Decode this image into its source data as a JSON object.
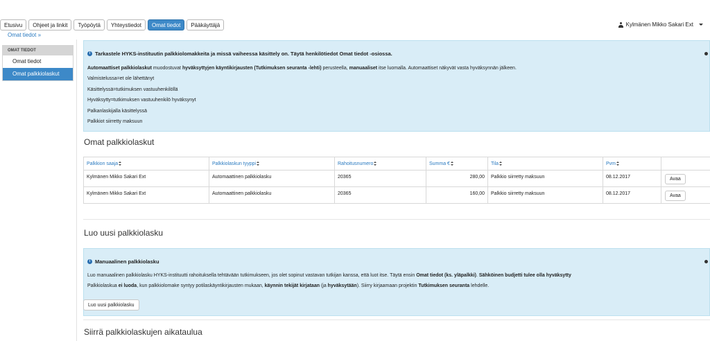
{
  "nav": {
    "tabs": [
      {
        "label": "Etusivu"
      },
      {
        "label": "Ohjeet ja linkit"
      },
      {
        "label": "Työpöytä"
      },
      {
        "label": "Yhteystiedot"
      },
      {
        "label": "Omat tiedot",
        "active": true
      },
      {
        "label": "Pääkäyttäjä"
      }
    ]
  },
  "user": {
    "name": "Kylmänen Mikko Sakari Ext"
  },
  "breadcrumb": "Omat tiedot »",
  "sidebar": {
    "header": "OMAT TIEDOT",
    "items": [
      {
        "label": "Omat tiedot"
      },
      {
        "label": "Omat palkkiolaskut",
        "active": true
      }
    ]
  },
  "info1": {
    "title": "Tarkastele HYKS-instituutin palkkiolomakkeita ja missä vaiheessa käsittely on. Täytä henkilötiedot Omat tiedot -osiossa.",
    "p1_b1": "Automaattiset palkkiolaskut",
    "p1_t1": " muodostuvat ",
    "p1_b2": "hyväksyttyjen käyntikirjausten (Tutkimuksen seuranta -lehti)",
    "p1_t2": " perusteella, ",
    "p1_b3": "manuaaliset",
    "p1_t3": " itse luomalla. Automaattiset näkyvät vasta hyväksynnän jälkeen.",
    "statuses": [
      "Valmistelussa=et ole lähettänyt",
      "Käsittelyssä=tutkimuksen vastuuhenkilöllä",
      "Hyväksytty=tutkimuksen vastuuhenkilö hyväksynyt",
      "Palkanlaskijalla käsittelyssä",
      "Palkkiot siirretty maksuun"
    ]
  },
  "section1_title": "Omat palkkiolaskut",
  "table": {
    "columns": [
      "Palkkion saaja",
      "Palkkiolaskun tyyppi",
      "Rahoitusnumero",
      "Summa €",
      "Tila",
      "Pvm"
    ],
    "rows": [
      {
        "saaja": "Kylmänen Mikko Sakari Ext",
        "tyyppi": "Automaattinen palkkiolasku",
        "rahoitus": "20365",
        "summa": "280,00",
        "tila": "Palkkio siirretty maksuun",
        "pvm": "08.12.2017",
        "action": "Avaa"
      },
      {
        "saaja": "Kylmänen Mikko Sakari Ext",
        "tyyppi": "Automaattinen palkkiolasku",
        "rahoitus": "20365",
        "summa": "160,00",
        "tila": "Palkkio siirretty maksuun",
        "pvm": "08.12.2017",
        "action": "Avaa"
      }
    ]
  },
  "section2_title": "Luo uusi palkkiolasku",
  "info2": {
    "title": "Manuaalinen palkkiolasku",
    "l1_t1": "Luo manuaalinen palkkiolasku HYKS-instituutti rahoituksella tehtävään tutkimukseen, jos olet sopinut vastavan tutkijan kanssa, että luot itse. Täytä ensin ",
    "l1_b1": "Omat tiedot (ks. yläpalkki)",
    "l1_t2": ". ",
    "l1_b2": "Sähköinen budjetti tulee olla hyväksytty",
    "l2_t1": "Palkkiolaskua ",
    "l2_b1": "ei luoda",
    "l2_t2": ", kun palkkiolomake syntyy potilaskäyntikirjausten mukaan, ",
    "l2_b2": "käynnin tekijät kirjataan",
    "l2_t3": " (ja ",
    "l2_b3": "hyväksytään",
    "l2_t4": "). Siirry kirjaamaan projektin ",
    "l2_b4": "Tutkimuksen seuranta",
    "l2_t5": " lehdelle."
  },
  "new_button": "Luo uusi palkkiolasku",
  "section3_title": "Siirrä palkkiolaskujen aikataulua"
}
